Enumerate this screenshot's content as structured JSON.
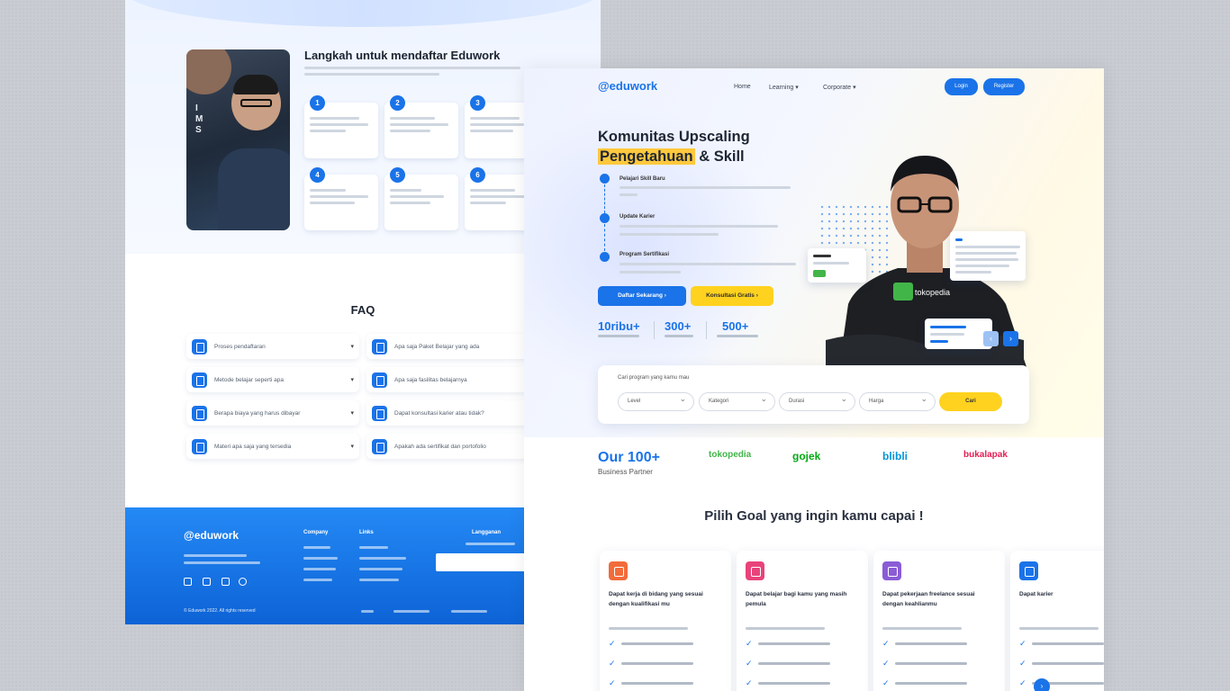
{
  "left_page": {
    "steps": {
      "title": "Langkah untuk mendaftar Eduwork",
      "numbers": [
        "1",
        "2",
        "3",
        "4",
        "5",
        "6"
      ]
    },
    "faq": {
      "title": "FAQ",
      "items": [
        "Proses pendaftaran",
        "Apa saja Paket Belajar yang ada",
        "Metode belajar seperti apa",
        "Apa saja fasilitas belajarnya",
        "Berapa biaya yang harus dibayar",
        "Dapat konsultasi karier atau tidak?",
        "Materi apa saja yang tersedia",
        "Apakah ada sertifikat dan portofolio"
      ]
    },
    "footer": {
      "logo": "@eduwork",
      "col1_title": "Company",
      "col2_title": "Links",
      "col3_title": "Langganan",
      "copyright": "© Eduwork 2022. All rights reserved"
    }
  },
  "right_page": {
    "nav": {
      "logo": "@eduwork",
      "links": [
        "Home",
        "Learning ▾",
        "Corporate ▾"
      ],
      "login": "Login",
      "register": "Register"
    },
    "hero": {
      "title_line1": "Komunitas Upscaling",
      "title_highlight": "Pengetahuan",
      "title_rest": " & Skill",
      "steps": [
        "Pelajari Skill Baru",
        "Update Karier",
        "Program Sertifikasi"
      ],
      "cta_primary": "Daftar Sekarang ›",
      "cta_secondary": "Konsultasi Gratis ›",
      "stats": [
        "10ribu+",
        "300+",
        "500+"
      ]
    },
    "search": {
      "label": "Cari program yang kamu mau",
      "selects": [
        "Level",
        "Kategori",
        "Durasi",
        "Harga"
      ],
      "button": "Cari"
    },
    "partners": {
      "count": "Our 100+",
      "label": "Business Partner",
      "logos": [
        "tokopedia",
        "gojek",
        "blibli",
        "bukalapak"
      ]
    },
    "goal": {
      "title": "Pilih Goal yang ingin kamu capai !",
      "cards": [
        {
          "text": "Dapat kerja di bidang yang sesuai dengan kualifikasi mu",
          "color": "#f26b3a"
        },
        {
          "text": "Dapat belajar bagi kamu yang masih pemula",
          "color": "#e8437a"
        },
        {
          "text": "Dapat pekerjaan freelance sesuai dengan keahlianmu",
          "color": "#8a5cd6"
        },
        {
          "text": "Dapat karier",
          "color": "#1a73e8"
        }
      ]
    }
  }
}
